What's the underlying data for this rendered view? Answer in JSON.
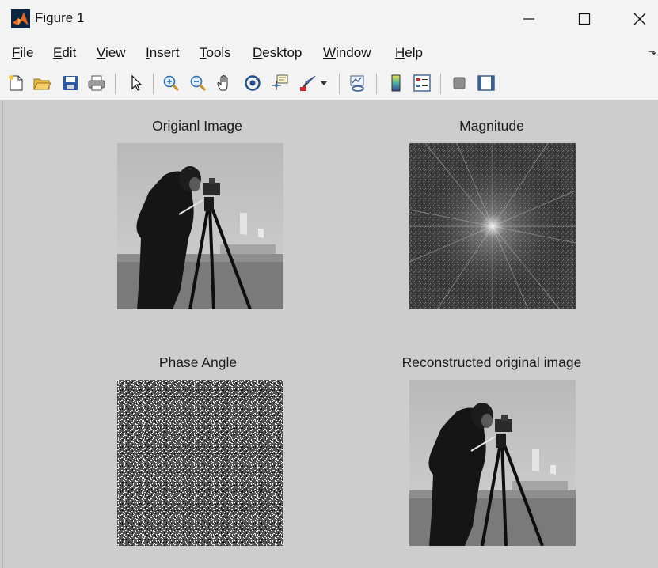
{
  "window": {
    "title": "Figure 1",
    "app_icon": "matlab-icon",
    "controls": [
      "minimize-icon",
      "maximize-icon",
      "close-icon"
    ]
  },
  "menu": [
    {
      "key": "F",
      "rest": "ile"
    },
    {
      "key": "E",
      "rest": "dit"
    },
    {
      "key": "V",
      "rest": "iew"
    },
    {
      "key": "I",
      "rest": "nsert"
    },
    {
      "key": "T",
      "rest": "ools"
    },
    {
      "key": "D",
      "rest": "esktop"
    },
    {
      "key": "W",
      "rest": "indow"
    },
    {
      "key": "H",
      "rest": "elp"
    }
  ],
  "toolbar": [
    "new-figure-icon",
    "open-file-icon",
    "save-icon",
    "print-icon",
    "edit-plot-arrow-icon",
    "zoom-in-icon",
    "zoom-out-icon",
    "pan-hand-icon",
    "rotate-3d-icon",
    "data-cursor-icon",
    "brush-icon",
    "brush-dropdown-icon",
    "link-plot-icon",
    "insert-colorbar-icon",
    "insert-legend-icon",
    "hide-plot-tools-icon",
    "show-plot-tools-icon"
  ],
  "subplots": [
    {
      "title": "Origianl Image"
    },
    {
      "title": "Magnitude"
    },
    {
      "title": "Phase Angle"
    },
    {
      "title": "Reconstructed original image"
    }
  ]
}
